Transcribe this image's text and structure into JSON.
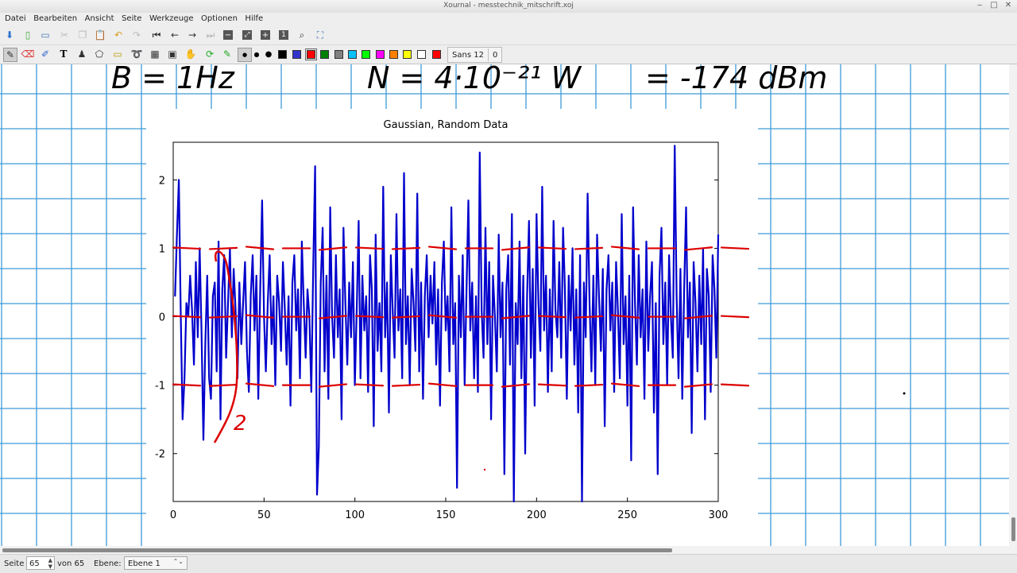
{
  "window": {
    "title": "Xournal - messtechnik_mitschrift.xoj"
  },
  "menu": [
    "Datei",
    "Bearbeiten",
    "Ansicht",
    "Seite",
    "Werkzeuge",
    "Optionen",
    "Hilfe"
  ],
  "toolbar": {
    "file_icons": [
      "save-icon",
      "new-page-icon",
      "open-icon",
      "cut-icon",
      "copy-icon",
      "paste-icon",
      "undo-icon",
      "redo-icon",
      "first-page-icon",
      "previous-page-icon",
      "next-page-icon",
      "last-page-icon",
      "zoom-out-icon",
      "zoom-fit-icon",
      "zoom-in-icon",
      "zoom-100-icon",
      "search-icon",
      "fullscreen-icon"
    ],
    "tool_icons": [
      "pen-icon",
      "eraser-icon",
      "highlighter-icon",
      "text-icon",
      "image-icon",
      "shape-icon",
      "ruler-icon",
      "lasso-icon",
      "rect-select-icon",
      "hand-icon",
      "refresh-icon",
      "pen-default-icon"
    ],
    "colors": [
      "#000000",
      "#3333cc",
      "#ff0000",
      "#008000",
      "#808080",
      "#00c0ff",
      "#00ff00",
      "#ff00ff",
      "#ff8000",
      "#ffff00",
      "#ffffff",
      "#ff0000"
    ],
    "selected_color": "#ff0000",
    "font_name": "Sans 12",
    "font_extra": "0"
  },
  "notes": {
    "top_line": {
      "b": "B = 1Hz",
      "n": "N = 4·10⁻²¹ W",
      "dbm": "= -174 dBm"
    },
    "annotation": "2"
  },
  "chart_data": {
    "type": "line",
    "title": "Gaussian, Random Data",
    "xlim": [
      0,
      300
    ],
    "ylim": [
      -2.7,
      2.55
    ],
    "xticks": [
      0,
      50,
      100,
      150,
      200,
      250,
      300
    ],
    "yticks": [
      2,
      1,
      0,
      -1,
      -2
    ],
    "series_color": "#0000cc",
    "annotation_color": "#dd0000",
    "series": [
      {
        "values": [
          0.3,
          1.2,
          2.0,
          0.1,
          -1.5,
          -0.9,
          0.2,
          0.0,
          0.6,
          0.1,
          -0.7,
          0.8,
          -0.3,
          1.0,
          -0.2,
          -1.8,
          -0.4,
          0.6,
          -0.9,
          -1.2,
          0.3,
          0.5,
          -0.8,
          1.1,
          -1.5,
          0.4,
          0.9,
          -0.6,
          0.2,
          1.0,
          -0.3,
          0.7,
          0.1,
          -0.9,
          0.5,
          -0.4,
          0.2,
          0.8,
          -0.5,
          -1.1,
          0.3,
          0.9,
          -0.2,
          0.6,
          -1.2,
          0.4,
          1.7,
          0.0,
          -0.8,
          0.2,
          0.9,
          -0.4,
          0.3,
          -1.0,
          0.6,
          0.2,
          -0.5,
          0.8,
          0.1,
          -0.7,
          0.3,
          -1.3,
          0.5,
          0.9,
          -0.2,
          0.4,
          -0.9,
          1.1,
          0.2,
          -0.6,
          0.4,
          0.0,
          -1.1,
          0.7,
          2.2,
          -2.6,
          -1.9,
          0.5,
          1.3,
          -0.8,
          0.6,
          -1.2,
          1.6,
          0.0,
          -0.6,
          0.9,
          -0.3,
          0.4,
          -1.5,
          1.3,
          0.2,
          -0.7,
          0.5,
          -0.3,
          0.8,
          -1.0,
          0.1,
          1.4,
          -0.9,
          0.6,
          -0.2,
          0.3,
          -1.1,
          0.9,
          0.4,
          -1.6,
          1.2,
          -0.5,
          0.2,
          -0.8,
          1.9,
          -0.3,
          0.5,
          -1.4,
          0.9,
          0.1,
          -0.6,
          1.5,
          -0.2,
          0.4,
          -0.9,
          2.1,
          -0.4,
          0.3,
          -1.0,
          0.7,
          0.2,
          -0.5,
          1.8,
          -0.8,
          0.5,
          -1.2,
          0.3,
          0.9,
          -0.3,
          0.6,
          -0.1,
          0.8,
          -0.7,
          0.4,
          -1.3,
          0.5,
          1.1,
          -0.2,
          0.3,
          -0.8,
          1.6,
          -0.4,
          0.2,
          -2.5,
          0.6,
          -0.3,
          0.9,
          -1.0,
          0.4,
          1.7,
          -0.2,
          0.5,
          -0.9,
          0.3,
          -1.1,
          2.4,
          0.1,
          -0.6,
          1.3,
          -0.4,
          0.8,
          -1.5,
          0.6,
          0.0,
          -0.8,
          1.2,
          -0.3,
          0.5,
          -2.3,
          0.4,
          0.9,
          -0.7,
          1.5,
          -2.7,
          0.2,
          -0.4,
          1.1,
          -0.9,
          0.6,
          -2.0,
          0.3,
          1.4,
          -0.6,
          0.7,
          -1.3,
          1.5,
          0.2,
          -0.5,
          1.9,
          -0.2,
          0.6,
          -1.1,
          0.4,
          -0.8,
          1.4,
          0.1,
          -0.3,
          0.8,
          -0.6,
          1.3,
          0.4,
          -1.2,
          0.6,
          -0.2,
          1.0,
          -0.7,
          0.4,
          -1.4,
          0.9,
          -2.7,
          0.5,
          -0.3,
          1.8,
          0.2,
          -0.8,
          0.6,
          -1.0,
          1.2,
          0.3,
          -0.5,
          0.7,
          -1.6,
          0.4,
          0.9,
          -0.2,
          0.5,
          -1.1,
          0.8,
          0.1,
          -0.9,
          1.5,
          -0.4,
          0.3,
          -1.3,
          0.6,
          -2.1,
          1.6,
          0.2,
          -0.7,
          0.9,
          -0.3,
          0.4,
          -1.2,
          1.1,
          -0.5,
          0.3,
          0.8,
          -1.4,
          0.2,
          -2.3,
          0.6,
          1.3,
          -0.4,
          0.5,
          -1.0,
          0.9,
          0.0,
          -0.6,
          2.5,
          0.3,
          -0.9,
          0.7,
          -1.2,
          0.4,
          1.6,
          -0.3,
          0.5,
          -1.7,
          0.8,
          0.2,
          -0.8,
          0.6,
          -0.4,
          1.0,
          -1.5,
          0.7,
          0.3,
          -1.1,
          0.9,
          0.4,
          -0.6,
          1.2
        ]
      }
    ]
  },
  "status": {
    "page_label": "Seite",
    "page_value": "65",
    "of_label": "von 65",
    "layer_label": "Ebene:",
    "layer_value": "Ebene 1"
  }
}
